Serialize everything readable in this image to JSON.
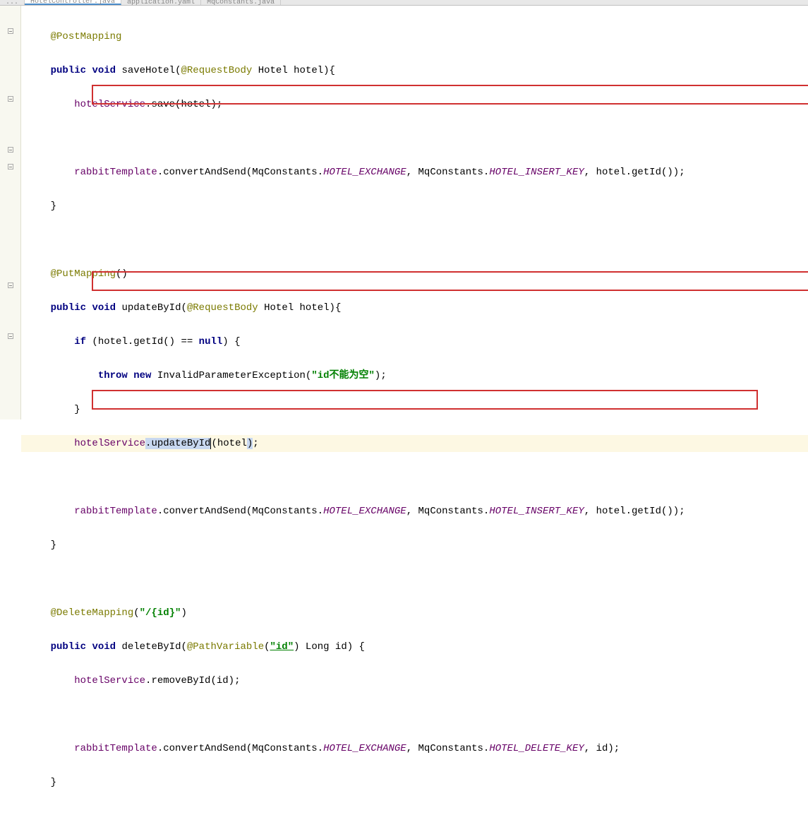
{
  "tabs": [
    {
      "label": "...",
      "active": false
    },
    {
      "label": "HotelController.java",
      "active": true
    },
    {
      "label": "application.yaml",
      "active": false
    },
    {
      "label": "MqConstants.java",
      "active": false
    }
  ],
  "code": {
    "postMapping": {
      "annotation": "@PostMapping",
      "signature": {
        "public": "public",
        "void": "void",
        "name": "saveHotel",
        "param_ann": "@RequestBody",
        "param_type": "Hotel",
        "param_name": "hotel"
      },
      "body1": {
        "field": "hotelService",
        "method": ".save(hotel);"
      },
      "body2": {
        "field": "rabbitTemplate",
        "method1": ".convertAndSend(MqConstants.",
        "const1": "HOTEL_EXCHANGE",
        "mid": ", MqConstants.",
        "const2": "HOTEL_INSERT_KEY",
        "tail": ", hotel.getId());"
      }
    },
    "putMapping": {
      "annotation": "@PutMapping",
      "annArgs": "()",
      "signature": {
        "public": "public",
        "void": "void",
        "name": "updateById",
        "param_ann": "@RequestBody",
        "param_type": "Hotel",
        "param_name": "hotel"
      },
      "ifline": {
        "if": "if",
        "cond": " (hotel.getId() == ",
        "null": "null",
        "close": ") {"
      },
      "throwline": {
        "throw": "throw",
        "new": "new",
        "exc": " InvalidParameterException(",
        "msg": "\"id不能为空\"",
        "close": ");"
      },
      "closeif": "}",
      "body1": {
        "field": "hotelService",
        "sel_method": ".updateById",
        "sel_paren_l": "(",
        "sel_arg": "hotel",
        "sel_paren_r": ")",
        "semi": ";"
      },
      "body2": {
        "field": "rabbitTemplate",
        "method1": ".convertAndSend(MqConstants.",
        "const1": "HOTEL_EXCHANGE",
        "mid": ", MqConstants.",
        "const2": "HOTEL_INSERT_KEY",
        "tail": ", hotel.getId());"
      }
    },
    "deleteMapping": {
      "annotation": "@DeleteMapping",
      "annOpen": "(",
      "annPath": "\"/{id}\"",
      "annClose": ")",
      "signature": {
        "public": "public",
        "void": "void",
        "name": "deleteById",
        "param_ann": "@PathVariable",
        "pv_open": "(",
        "pv_val": "\"id\"",
        "pv_close": ")",
        "param_type": " Long",
        "param_name": " id"
      },
      "body1": {
        "field": "hotelService",
        "method": ".removeById(id);"
      },
      "body2": {
        "field": "rabbitTemplate",
        "method1": ".convertAndSend(MqConstants.",
        "const1": "HOTEL_EXCHANGE",
        "mid": ", MqConstants.",
        "const2": "HOTEL_DELETE_KEY",
        "tail": ", id);"
      }
    }
  }
}
